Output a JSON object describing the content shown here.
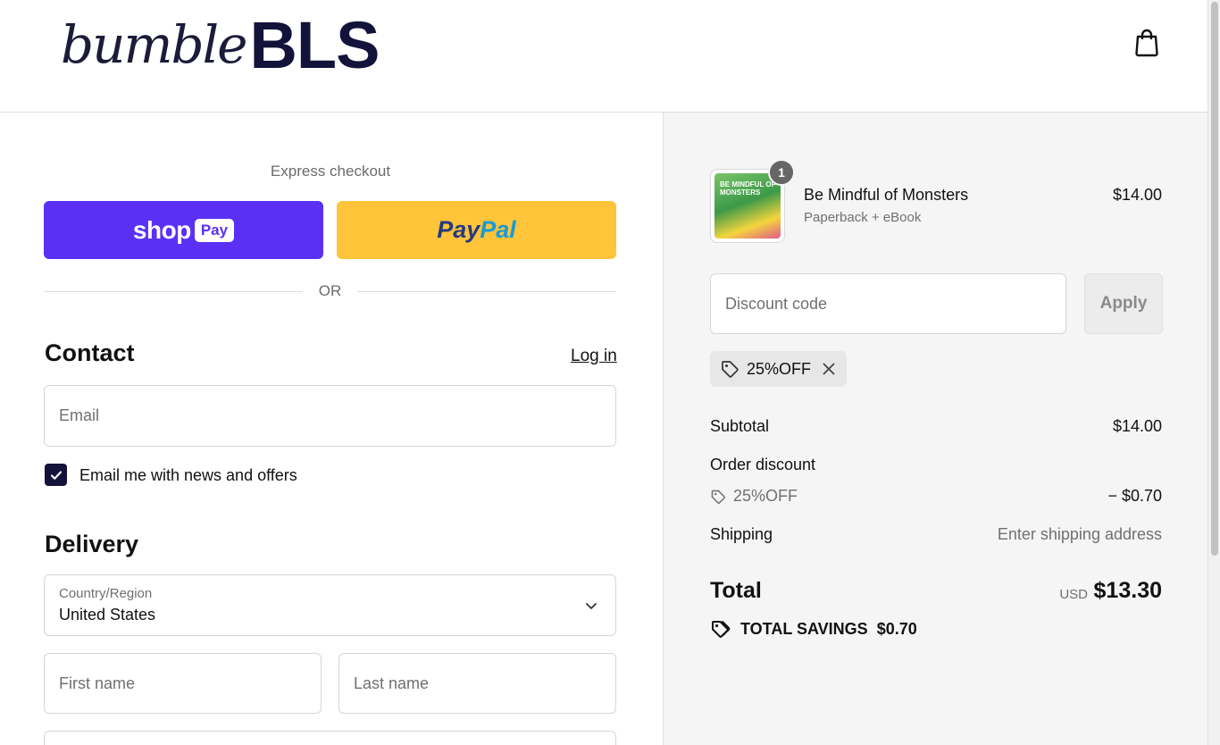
{
  "header": {
    "logo_script": "bumble",
    "logo_bold": "BLS",
    "cart_icon": "shopping-bag-icon"
  },
  "express": {
    "title": "Express checkout",
    "shop_word": "shop",
    "shop_pay": "Pay",
    "paypal_pay": "Pay",
    "paypal_pal": "Pal",
    "or_text": "OR"
  },
  "contact": {
    "title": "Contact",
    "login_label": "Log in",
    "email_placeholder": "Email",
    "newsletter_label": "Email me with news and offers",
    "newsletter_checked": true
  },
  "delivery": {
    "title": "Delivery",
    "country_label": "Country/Region",
    "country_value": "United States",
    "first_name_placeholder": "First name",
    "last_name_placeholder": "Last name"
  },
  "order": {
    "product": {
      "name": "Be Mindful of Monsters",
      "variant": "Paperback + eBook",
      "price": "$14.00",
      "quantity": "1",
      "cover_text": "BE MINDFUL OF MONSTERS"
    },
    "discount_placeholder": "Discount code",
    "apply_label": "Apply",
    "applied_code": "25%OFF",
    "subtotal_label": "Subtotal",
    "subtotal_value": "$14.00",
    "order_discount_label": "Order discount",
    "discount_code": "25%OFF",
    "discount_value": "− $0.70",
    "shipping_label": "Shipping",
    "shipping_value": "Enter shipping address",
    "total_label": "Total",
    "total_currency": "USD",
    "total_value": "$13.30",
    "savings_label": "TOTAL SAVINGS",
    "savings_value": "$0.70"
  },
  "colors": {
    "shop_pay": "#5a31f4",
    "paypal": "#ffc439",
    "brand_dark": "#13123a",
    "summary_bg": "#f5f5f5"
  }
}
